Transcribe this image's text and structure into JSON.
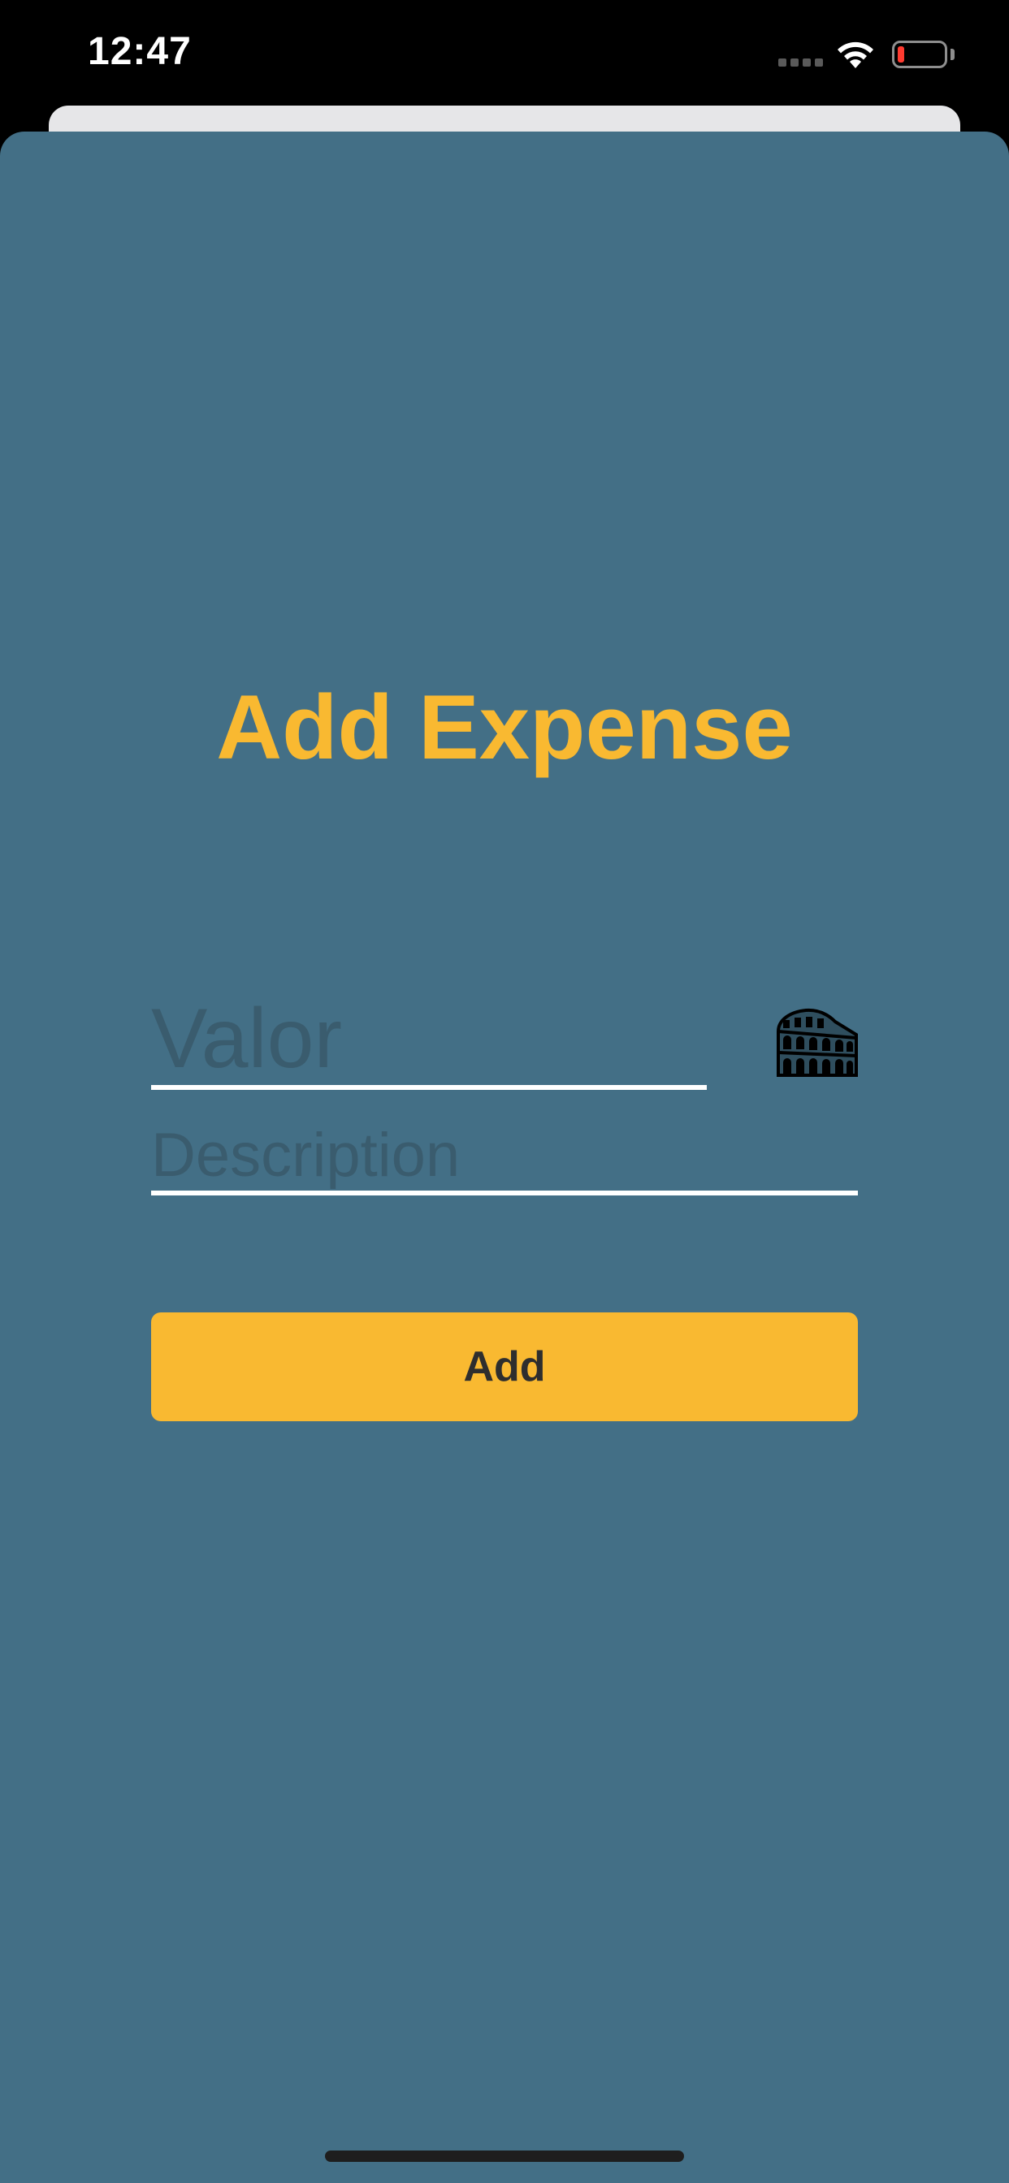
{
  "status_bar": {
    "time": "12:47",
    "signal_icon": "cellular-signal-icon",
    "wifi_icon": "wifi-icon",
    "battery_icon": "battery-low-icon",
    "battery_color": "#ff3b30"
  },
  "form": {
    "title": "Add Expense",
    "value_placeholder": "Valor",
    "currency_icon": "coliseum-icon",
    "description_placeholder": "Description",
    "add_label": "Add"
  },
  "colors": {
    "background": "#436f86",
    "accent": "#f9b931",
    "button_text": "#2e2e2e",
    "underline": "#ffffff"
  }
}
